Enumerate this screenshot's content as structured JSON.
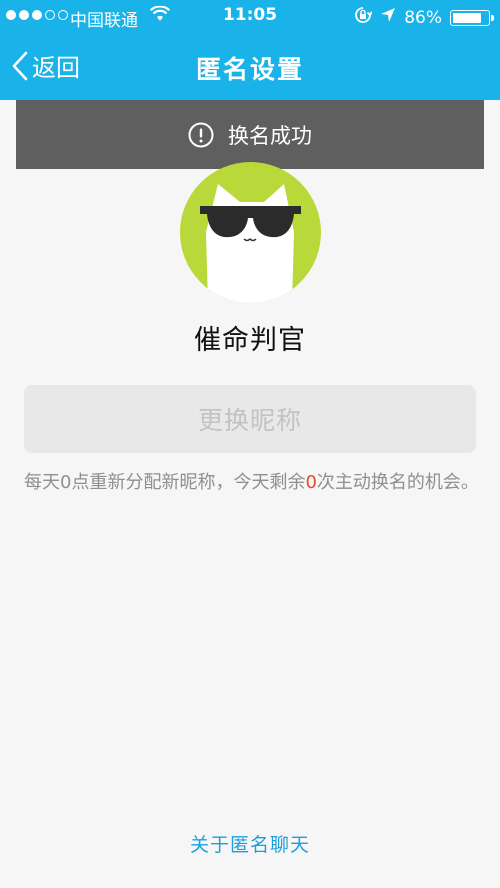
{
  "status_bar": {
    "signal_filled": 3,
    "signal_total": 5,
    "carrier": "中国联通",
    "time": "11:05",
    "battery_percent_label": "86%",
    "battery_level": 0.86
  },
  "nav": {
    "back_label": "返回",
    "title": "匿名设置"
  },
  "toast": {
    "message": "换名成功",
    "icon": "exclamation-circle-icon"
  },
  "profile": {
    "avatar_icon": "cat-with-sunglasses-avatar",
    "nickname": "催命判官"
  },
  "change_button": {
    "label": "更换昵称",
    "enabled": false
  },
  "note": {
    "text_before": "每天0点重新分配新昵称，今天剩余",
    "remaining_count": "0",
    "text_after": "次主动换名的机会。"
  },
  "footer": {
    "about_link": "关于匿名聊天"
  },
  "colors": {
    "header": "#19b3ea",
    "avatar_bg": "#b9d93a",
    "accent_red": "#e84a2b",
    "link": "#1aa0dd"
  }
}
